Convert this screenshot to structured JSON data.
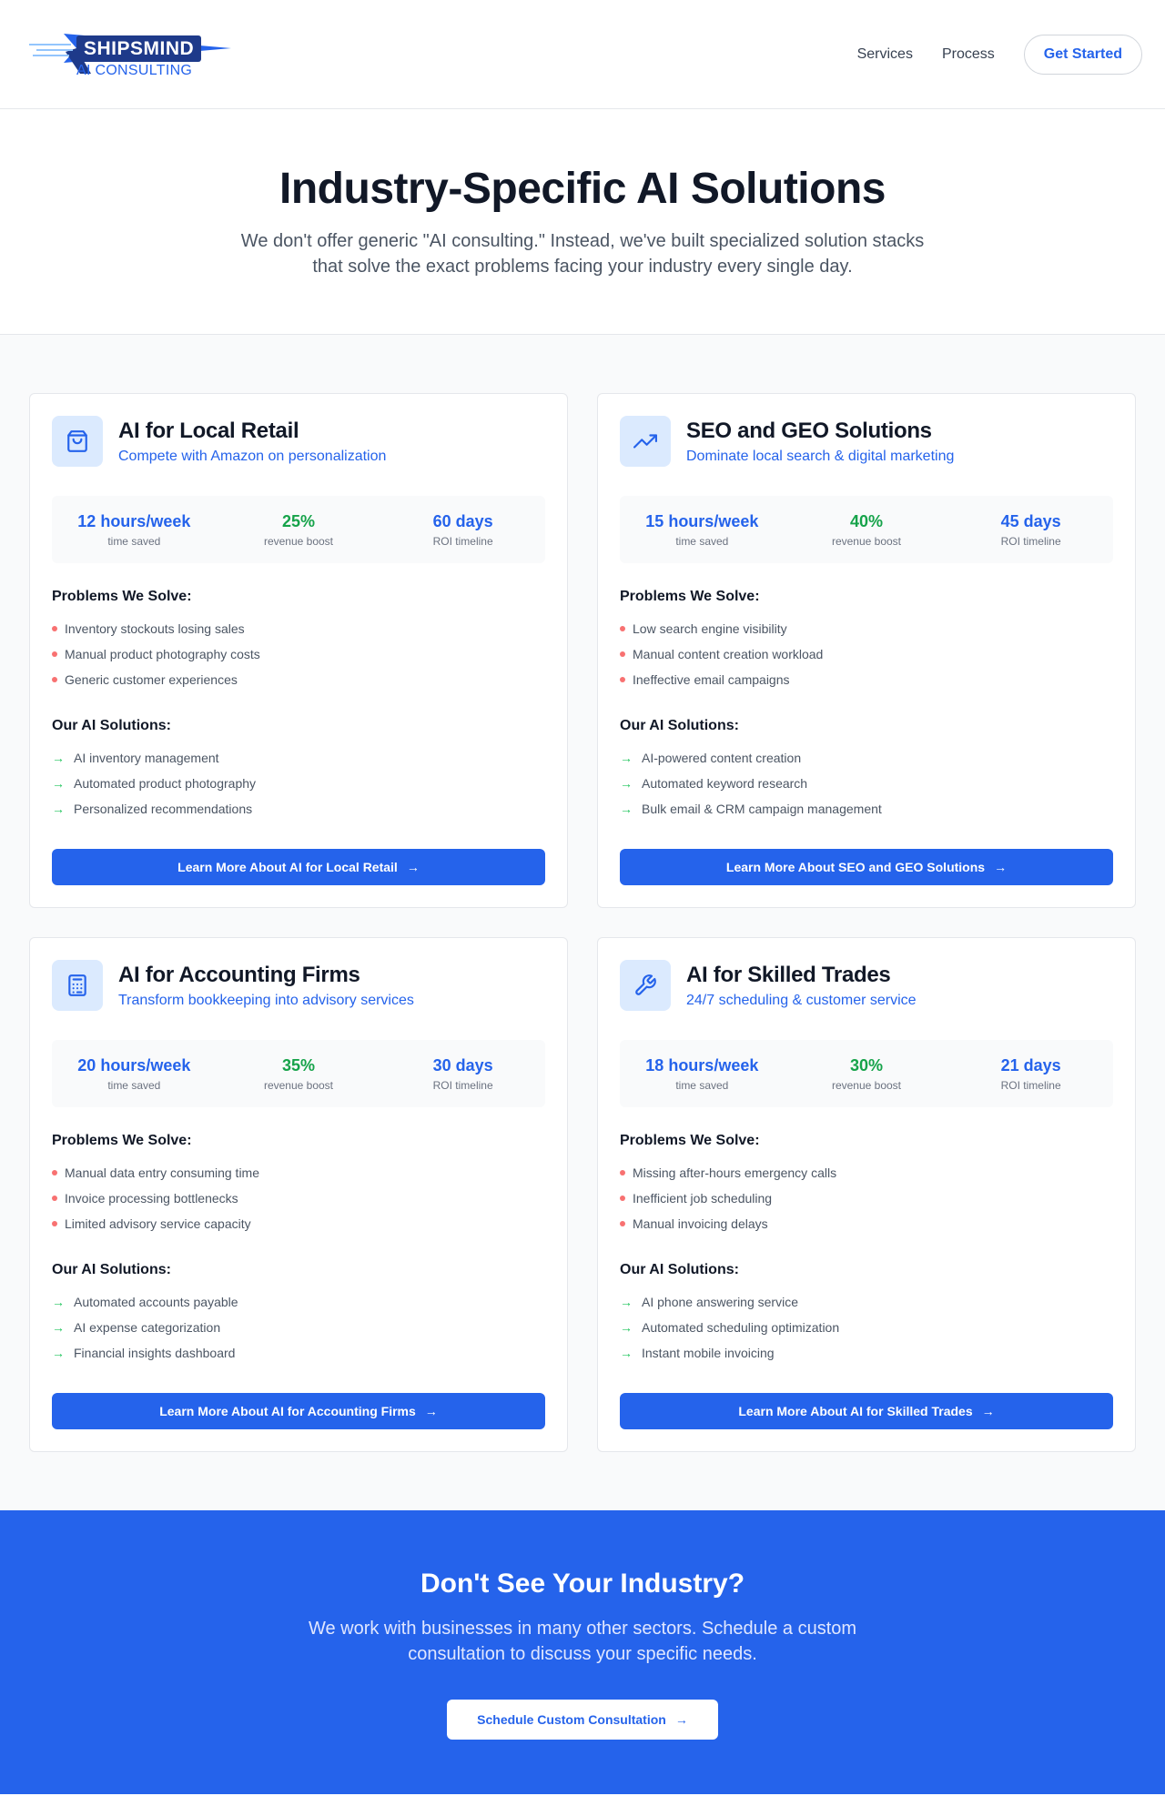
{
  "header": {
    "brand": "SHIPSMIND",
    "tagline": "AI CONSULTING",
    "nav": [
      "Services",
      "Process"
    ],
    "cta": "Get Started"
  },
  "hero": {
    "title": "Industry-Specific AI Solutions",
    "subtitle": "We don't offer generic \"AI consulting.\" Instead, we've built specialized solution stacks that solve the exact problems facing your industry every single day."
  },
  "cards": [
    {
      "icon": "shopping-bag-icon",
      "title": "AI for Local Retail",
      "subtitle": "Compete with Amazon on personalization",
      "stats": [
        {
          "value": "12 hours/week",
          "label": "time saved"
        },
        {
          "value": "25%",
          "label": "revenue boost"
        },
        {
          "value": "60 days",
          "label": "ROI timeline"
        }
      ],
      "problems_title": "Problems We Solve:",
      "problems": [
        "Inventory stockouts losing sales",
        "Manual product photography costs",
        "Generic customer experiences"
      ],
      "solutions_title": "Our AI Solutions:",
      "solutions": [
        "AI inventory management",
        "Automated product photography",
        "Personalized recommendations"
      ],
      "button": "Learn More About AI for Local Retail"
    },
    {
      "icon": "trending-up-icon",
      "title": "SEO and GEO Solutions",
      "subtitle": "Dominate local search & digital marketing",
      "stats": [
        {
          "value": "15 hours/week",
          "label": "time saved"
        },
        {
          "value": "40%",
          "label": "revenue boost"
        },
        {
          "value": "45 days",
          "label": "ROI timeline"
        }
      ],
      "problems_title": "Problems We Solve:",
      "problems": [
        "Low search engine visibility",
        "Manual content creation workload",
        "Ineffective email campaigns"
      ],
      "solutions_title": "Our AI Solutions:",
      "solutions": [
        "AI-powered content creation",
        "Automated keyword research",
        "Bulk email & CRM campaign management"
      ],
      "button": "Learn More About SEO and GEO Solutions"
    },
    {
      "icon": "calculator-icon",
      "title": "AI for Accounting Firms",
      "subtitle": "Transform bookkeeping into advisory services",
      "stats": [
        {
          "value": "20 hours/week",
          "label": "time saved"
        },
        {
          "value": "35%",
          "label": "revenue boost"
        },
        {
          "value": "30 days",
          "label": "ROI timeline"
        }
      ],
      "problems_title": "Problems We Solve:",
      "problems": [
        "Manual data entry consuming time",
        "Invoice processing bottlenecks",
        "Limited advisory service capacity"
      ],
      "solutions_title": "Our AI Solutions:",
      "solutions": [
        "Automated accounts payable",
        "AI expense categorization",
        "Financial insights dashboard"
      ],
      "button": "Learn More About AI for Accounting Firms"
    },
    {
      "icon": "wrench-icon",
      "title": "AI for Skilled Trades",
      "subtitle": "24/7 scheduling & customer service",
      "stats": [
        {
          "value": "18 hours/week",
          "label": "time saved"
        },
        {
          "value": "30%",
          "label": "revenue boost"
        },
        {
          "value": "21 days",
          "label": "ROI timeline"
        }
      ],
      "problems_title": "Problems We Solve:",
      "problems": [
        "Missing after-hours emergency calls",
        "Inefficient job scheduling",
        "Manual invoicing delays"
      ],
      "solutions_title": "Our AI Solutions:",
      "solutions": [
        "AI phone answering service",
        "Automated scheduling optimization",
        "Instant mobile invoicing"
      ],
      "button": "Learn More About AI for Skilled Trades"
    }
  ],
  "cta_section": {
    "title": "Don't See Your Industry?",
    "text": "We work with businesses in many other sectors. Schedule a custom consultation to discuss your specific needs.",
    "button": "Schedule Custom Consultation"
  },
  "colors": {
    "accent": "#2563eb",
    "green": "#16a34a",
    "problem_dot": "#f87171"
  }
}
